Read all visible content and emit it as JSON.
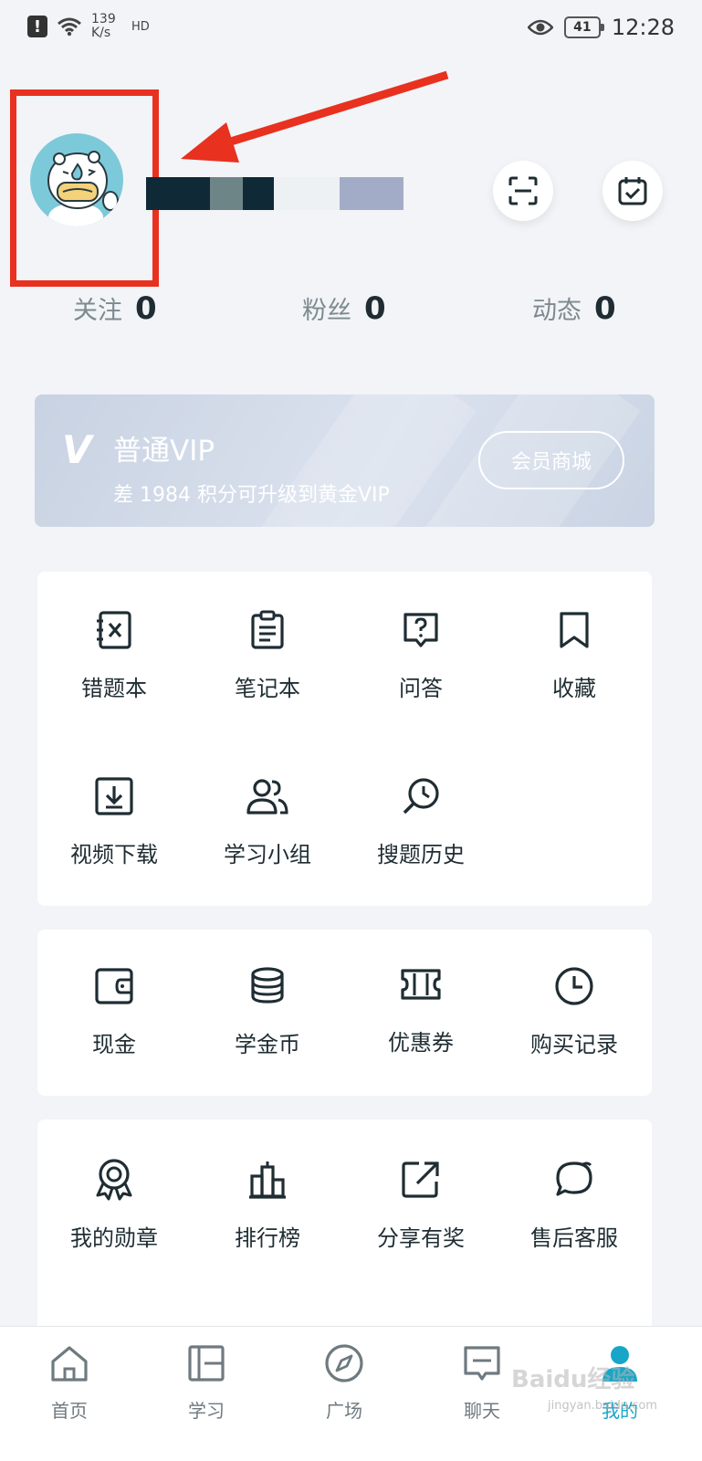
{
  "status_bar": {
    "alert_glyph": "!",
    "net_speed_value": "139",
    "net_speed_unit": "K/s",
    "hd_label": "HD",
    "battery": "41",
    "time": "12:28"
  },
  "profile": {
    "username_hidden": "",
    "stats": [
      {
        "label": "关注",
        "value": "0"
      },
      {
        "label": "粉丝",
        "value": "0"
      },
      {
        "label": "动态",
        "value": "0"
      }
    ]
  },
  "vip": {
    "logo": "V",
    "title": "普通VIP",
    "subtitle": "差 1984 积分可升级到黄金VIP",
    "button": "会员商城"
  },
  "menu_study": [
    {
      "label": "错题本",
      "icon": "wrong-book-icon"
    },
    {
      "label": "笔记本",
      "icon": "notebook-icon"
    },
    {
      "label": "问答",
      "icon": "question-icon"
    },
    {
      "label": "收藏",
      "icon": "bookmark-icon"
    },
    {
      "label": "视频下载",
      "icon": "download-icon"
    },
    {
      "label": "学习小组",
      "icon": "group-icon"
    },
    {
      "label": "搜题历史",
      "icon": "search-history-icon"
    }
  ],
  "menu_wallet": [
    {
      "label": "现金",
      "icon": "wallet-icon"
    },
    {
      "label": "学金币",
      "icon": "coins-icon"
    },
    {
      "label": "优惠券",
      "icon": "coupon-icon"
    },
    {
      "label": "购买记录",
      "icon": "clock-icon"
    }
  ],
  "menu_more": [
    {
      "label": "我的勋章",
      "icon": "medal-icon"
    },
    {
      "label": "排行榜",
      "icon": "ranking-icon"
    },
    {
      "label": "分享有奖",
      "icon": "share-icon"
    },
    {
      "label": "售后客服",
      "icon": "service-icon"
    }
  ],
  "bottom_nav": [
    {
      "label": "首页",
      "icon": "home-icon"
    },
    {
      "label": "学习",
      "icon": "study-icon"
    },
    {
      "label": "广场",
      "icon": "compass-icon"
    },
    {
      "label": "聊天",
      "icon": "chat-icon"
    },
    {
      "label": "我的",
      "icon": "profile-icon",
      "active": true
    }
  ],
  "watermark": {
    "text": "Baidu经验",
    "sub": "jingyan.baidu.com"
  },
  "colors": {
    "accent": "#18a6c8",
    "highlight": "#e8311f",
    "icon_stroke": "#1f2d33"
  }
}
